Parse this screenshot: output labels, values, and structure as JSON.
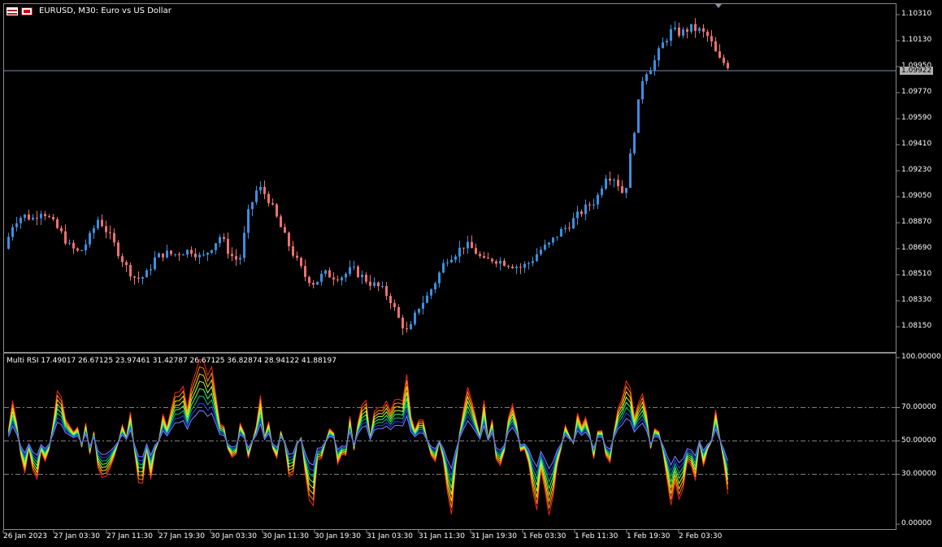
{
  "window": {
    "symbol_title": "EURUSD, M30:  Euro vs US Dollar"
  },
  "price_axis": {
    "ticks": [
      "1.10310",
      "1.10130",
      "1.09950",
      "1.09770",
      "1.09590",
      "1.09410",
      "1.09230",
      "1.09050",
      "1.08870",
      "1.08690",
      "1.08510",
      "1.08330",
      "1.08150"
    ],
    "current_price": "1.09922"
  },
  "indicator": {
    "label": "Multi RSI 17.49017 26.67125 23.97461 31.42787 26.67125 36.82874 28.94122 41.88197",
    "ticks": [
      "100.00000",
      "70.00000",
      "50.00000",
      "30.00000",
      "0.00000"
    ],
    "levels": [
      70,
      50,
      30
    ]
  },
  "time_axis": {
    "labels": [
      "26 Jan 2023",
      "27 Jan 03:30",
      "27 Jan 11:30",
      "27 Jan 19:30",
      "30 Jan 03:30",
      "30 Jan 11:30",
      "30 Jan 19:30",
      "31 Jan 03:30",
      "31 Jan 11:30",
      "31 Jan 19:30",
      "1 Feb 03:30",
      "1 Feb 11:30",
      "1 Feb 19:30",
      "2 Feb 03:30"
    ]
  },
  "colors": {
    "bull": "#3b8fe0",
    "bear": "#f07070",
    "grid_level": "#808080",
    "rsi_series": [
      "#ff2020",
      "#ff8c00",
      "#ffd700",
      "#b0ff40",
      "#40ff80",
      "#00c080",
      "#2040ff",
      "#8080ff"
    ]
  },
  "chart_data": {
    "type": "candlestick",
    "title": "EURUSD, M30:  Euro vs US Dollar",
    "ylim": [
      1.0806,
      1.104
    ],
    "close_path": [
      1.0869,
      1.0888,
      1.0892,
      1.089,
      1.0896,
      1.0888,
      1.088,
      1.087,
      1.0866,
      1.0876,
      1.089,
      1.088,
      1.0868,
      1.0856,
      1.0848,
      1.085,
      1.0862,
      1.0866,
      1.0865,
      1.0867,
      1.0868,
      1.0862,
      1.087,
      1.0878,
      1.0865,
      1.086,
      1.0895,
      1.0912,
      1.0905,
      1.089,
      1.0875,
      1.0862,
      1.085,
      1.0845,
      1.0852,
      1.085,
      1.085,
      1.0855,
      1.085,
      1.0845,
      1.0842,
      1.0835,
      1.082,
      1.081,
      1.0828,
      1.0836,
      1.0848,
      1.0862,
      1.0866,
      1.0872,
      1.0868,
      1.086,
      1.0862,
      1.086,
      1.0858,
      1.0856,
      1.086,
      1.0868,
      1.0872,
      1.088,
      1.0885,
      1.0892,
      1.0898,
      1.0903,
      1.092,
      1.0918,
      1.0905,
      1.095,
      1.099,
      1.0996,
      1.101,
      1.102,
      1.1018,
      1.1022,
      1.102,
      1.1015,
      1.1,
      1.0996
    ]
  }
}
